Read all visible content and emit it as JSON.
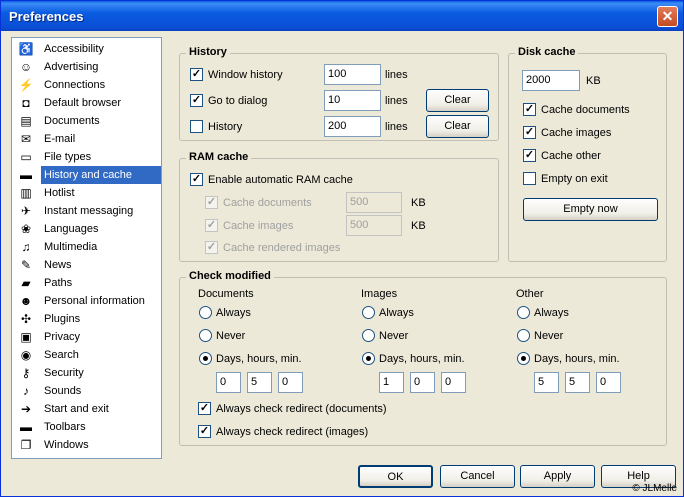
{
  "window": {
    "title": "Preferences",
    "close_label": "✕"
  },
  "sidebar": {
    "items": [
      {
        "label": "Accessibility",
        "icon": "accessibility-icon",
        "glyph": "♿"
      },
      {
        "label": "Advertising",
        "icon": "smiley-icon",
        "glyph": "☺"
      },
      {
        "label": "Connections",
        "icon": "plug-icon",
        "glyph": "⚡"
      },
      {
        "label": "Default browser",
        "icon": "browser-icon",
        "glyph": "◘"
      },
      {
        "label": "Documents",
        "icon": "document-icon",
        "glyph": "▤"
      },
      {
        "label": "E-mail",
        "icon": "envelope-icon",
        "glyph": "✉"
      },
      {
        "label": "File types",
        "icon": "file-icon",
        "glyph": "▭"
      },
      {
        "label": "History and cache",
        "icon": "drive-icon",
        "glyph": "▬"
      },
      {
        "label": "Hotlist",
        "icon": "hotlist-icon",
        "glyph": "▥"
      },
      {
        "label": "Instant messaging",
        "icon": "messaging-icon",
        "glyph": "✈"
      },
      {
        "label": "Languages",
        "icon": "languages-icon",
        "glyph": "❀"
      },
      {
        "label": "Multimedia",
        "icon": "multimedia-icon",
        "glyph": "♫"
      },
      {
        "label": "News",
        "icon": "news-icon",
        "glyph": "✎"
      },
      {
        "label": "Paths",
        "icon": "folder-icon",
        "glyph": "▰"
      },
      {
        "label": "Personal information",
        "icon": "person-icon",
        "glyph": "☻"
      },
      {
        "label": "Plugins",
        "icon": "plugin-icon",
        "glyph": "✣"
      },
      {
        "label": "Privacy",
        "icon": "privacy-icon",
        "glyph": "▣"
      },
      {
        "label": "Search",
        "icon": "search-icon",
        "glyph": "◉"
      },
      {
        "label": "Security",
        "icon": "key-icon",
        "glyph": "⚷"
      },
      {
        "label": "Sounds",
        "icon": "speaker-icon",
        "glyph": "♪"
      },
      {
        "label": "Start and exit",
        "icon": "start-icon",
        "glyph": "➔"
      },
      {
        "label": "Toolbars",
        "icon": "toolbar-icon",
        "glyph": "▬"
      },
      {
        "label": "Windows",
        "icon": "windows-icon",
        "glyph": "❐"
      }
    ],
    "selected_index": 7
  },
  "history": {
    "title": "History",
    "window_history": {
      "label": "Window history",
      "checked": true,
      "value": "100",
      "unit": "lines"
    },
    "goto_dialog": {
      "label": "Go to dialog",
      "checked": true,
      "value": "10",
      "unit": "lines",
      "clear": "Clear"
    },
    "history": {
      "label": "History",
      "checked": false,
      "value": "200",
      "unit": "lines",
      "clear": "Clear"
    }
  },
  "ram_cache": {
    "title": "RAM cache",
    "enable": {
      "label": "Enable automatic RAM cache",
      "checked": true
    },
    "cache_documents": {
      "label": "Cache documents",
      "value": "500",
      "unit": "KB"
    },
    "cache_images": {
      "label": "Cache images",
      "value": "500",
      "unit": "KB"
    },
    "cache_rendered": {
      "label": "Cache rendered images"
    }
  },
  "disk_cache": {
    "title": "Disk cache",
    "value": "2000",
    "unit": "KB",
    "cache_documents": {
      "label": "Cache documents",
      "checked": true
    },
    "cache_images": {
      "label": "Cache images",
      "checked": true
    },
    "cache_other": {
      "label": "Cache other",
      "checked": true
    },
    "empty_on_exit": {
      "label": "Empty on exit",
      "checked": false
    },
    "empty_now": "Empty now"
  },
  "check_modified": {
    "title": "Check modified",
    "always": "Always",
    "never": "Never",
    "days": "Days, hours, min.",
    "columns": [
      {
        "heading": "Documents",
        "selected": "days",
        "values": [
          "0",
          "5",
          "0"
        ]
      },
      {
        "heading": "Images",
        "selected": "days",
        "values": [
          "1",
          "0",
          "0"
        ]
      },
      {
        "heading": "Other",
        "selected": "days",
        "values": [
          "5",
          "5",
          "0"
        ]
      }
    ],
    "redirect_docs": {
      "label": "Always check redirect (documents)",
      "checked": true
    },
    "redirect_images": {
      "label": "Always check redirect (images)",
      "checked": true
    }
  },
  "buttons": {
    "ok": "OK",
    "cancel": "Cancel",
    "apply": "Apply",
    "help": "Help"
  },
  "copyright": "© JLMelle"
}
